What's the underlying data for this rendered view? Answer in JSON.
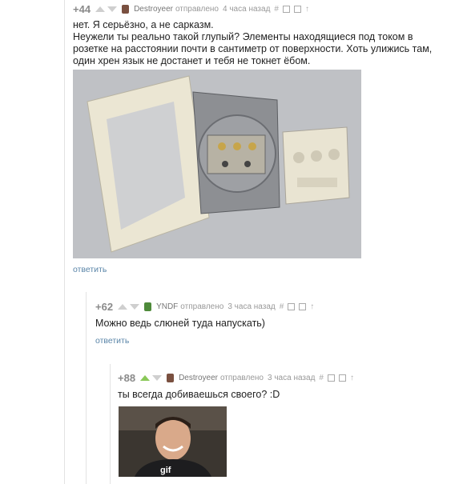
{
  "comments": [
    {
      "score": "+44",
      "author": "Destroyeer",
      "verb": "отправлено",
      "time": "4 часа назад",
      "hash": "#",
      "text": "нет. Я серьёзно, а не сарказм.\nНеужели ты реально такой глупый? Элементы находящиеся под током в розетке на расстоянии почти в сантиметр от поверхности. Хоть улижись там, один хрен язык не достанет и тебя не токнет ёбом.",
      "reply": "ответить",
      "avatar_color": "#7a5040"
    },
    {
      "score": "+62",
      "author": "YNDF",
      "verb": "отправлено",
      "time": "3 часа назад",
      "hash": "#",
      "text": "Можно ведь слюней туда напускать)",
      "reply": "ответить",
      "avatar_color": "#4e8a3a"
    },
    {
      "score": "+88",
      "author": "Destroyeer",
      "verb": "отправлено",
      "time": "3 часа назад",
      "hash": "#",
      "text": "ты всегда добиваешься своего? :D",
      "gif_label": "gif",
      "avatar_color": "#7a5040"
    }
  ],
  "colors": {
    "upvote_active": "#8ac858",
    "link": "#5a85a8"
  }
}
